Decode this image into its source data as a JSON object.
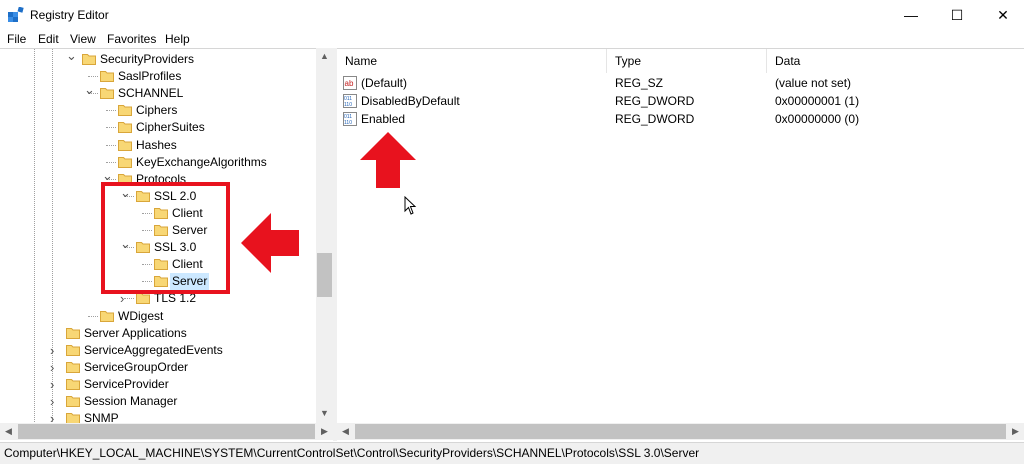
{
  "window": {
    "title": "Registry Editor",
    "minimize": "—",
    "maximize": "☐",
    "close": "✕"
  },
  "menu": [
    "File",
    "Edit",
    "View",
    "Favorites",
    "Help"
  ],
  "tree": {
    "items": [
      {
        "label": "SecurityProviders",
        "level": 0,
        "exp": "v"
      },
      {
        "label": "SaslProfiles",
        "level": 1,
        "exp": ""
      },
      {
        "label": "SCHANNEL",
        "level": 1,
        "exp": "v"
      },
      {
        "label": "Ciphers",
        "level": 2,
        "exp": ""
      },
      {
        "label": "CipherSuites",
        "level": 2,
        "exp": ""
      },
      {
        "label": "Hashes",
        "level": 2,
        "exp": ""
      },
      {
        "label": "KeyExchangeAlgorithms",
        "level": 2,
        "exp": ""
      },
      {
        "label": "Protocols",
        "level": 2,
        "exp": "v"
      },
      {
        "label": "SSL 2.0",
        "level": 3,
        "exp": "v"
      },
      {
        "label": "Client",
        "level": 4,
        "exp": ""
      },
      {
        "label": "Server",
        "level": 4,
        "exp": ""
      },
      {
        "label": "SSL 3.0",
        "level": 3,
        "exp": "v"
      },
      {
        "label": "Client",
        "level": 4,
        "exp": ""
      },
      {
        "label": "Server",
        "level": 4,
        "exp": "",
        "selected": true
      },
      {
        "label": "TLS 1.2",
        "level": 3,
        "exp": ">"
      },
      {
        "label": "WDigest",
        "level": 1,
        "exp": ""
      },
      {
        "label": "Server Applications",
        "level": -1,
        "exp": ""
      },
      {
        "label": "ServiceAggregatedEvents",
        "level": -1,
        "exp": ">"
      },
      {
        "label": "ServiceGroupOrder",
        "level": -1,
        "exp": ">"
      },
      {
        "label": "ServiceProvider",
        "level": -1,
        "exp": ">"
      },
      {
        "label": "Session Manager",
        "level": -1,
        "exp": ">"
      },
      {
        "label": "SNMP",
        "level": -1,
        "exp": ">"
      }
    ]
  },
  "list": {
    "columns": [
      "Name",
      "Type",
      "Data"
    ],
    "rows": [
      {
        "name": "(Default)",
        "type": "REG_SZ",
        "data": "(value not set)",
        "icon": "string-value-icon"
      },
      {
        "name": "DisabledByDefault",
        "type": "REG_DWORD",
        "data": "0x00000001 (1)",
        "icon": "dword-value-icon"
      },
      {
        "name": "Enabled",
        "type": "REG_DWORD",
        "data": "0x00000000 (0)",
        "icon": "dword-value-icon"
      }
    ]
  },
  "status": {
    "path": "Computer\\HKEY_LOCAL_MACHINE\\SYSTEM\\CurrentControlSet\\Control\\SecurityProviders\\SCHANNEL\\Protocols\\SSL 3.0\\Server"
  },
  "colors": {
    "annotation_red": "#e8121e",
    "folder_yellow": "#f8d775",
    "selection": "#cce8ff"
  }
}
